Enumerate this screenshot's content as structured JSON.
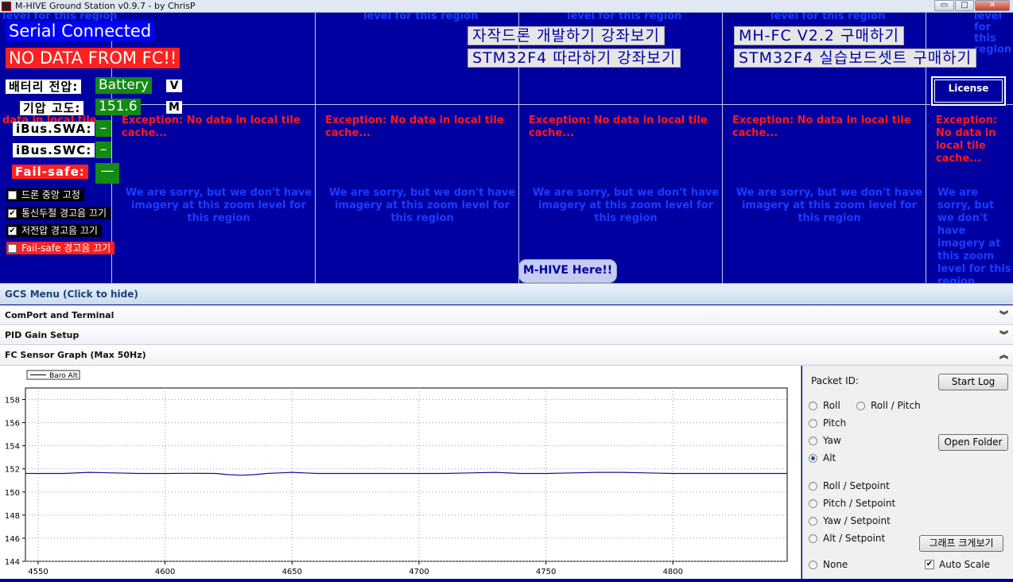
{
  "window": {
    "title": "M-HIVE Ground Station v0.9.7 - by ChrisP",
    "minimize_glyph": "▭",
    "maximize_glyph": "□",
    "close_glyph": "✕",
    "icon": "app-icon"
  },
  "map": {
    "tile_exception": "Exception: No data in local tile cache...",
    "tile_exception_cut": "data in local tile",
    "tile_sorry": "We are sorry, but we don't have imagery at this zoom level for this region",
    "tile_top_fragment": "level for this region",
    "marker": "M-HIVE Here!!"
  },
  "status": {
    "serial": "Serial Connected",
    "fc": "NO DATA FROM FC!!"
  },
  "telemetry": {
    "battery_label": "배터리 전압:",
    "battery_value": "Battery",
    "battery_unit": "V",
    "altitude_label": "기압 고도:",
    "altitude_value": "151.6",
    "altitude_unit": "M",
    "swa_label": "iBus.SWA:",
    "swa_value": "–",
    "swc_label": "iBus.SWC:",
    "swc_value": "–",
    "failsafe_label": "Fail-safe:",
    "failsafe_value": "—"
  },
  "options": [
    {
      "label": "드론 중앙 고정",
      "checked": false
    },
    {
      "label": "통신두절 경고음 끄기",
      "checked": true
    },
    {
      "label": "저전압 경고음 끄기",
      "checked": true
    },
    {
      "label": "Fail-safe 경고음 끄기",
      "checked": false
    }
  ],
  "check_glyph": "✔",
  "links": {
    "course1": "자작드론 개발하기 강좌보기",
    "course2": "STM32F4 따라하기 강좌보기",
    "buy1": "MH-FC V2.2 구매하기",
    "buy2": "STM32F4 실습보드셋트 구매하기",
    "license": "License"
  },
  "menu": {
    "gcs": "GCS Menu (Click to hide)",
    "panels": [
      {
        "label": "ComPort and Terminal",
        "chev": "︾"
      },
      {
        "label": "PID Gain Setup",
        "chev": "︾"
      },
      {
        "label": "FC Sensor Graph (Max 50Hz)",
        "chev": "︽"
      }
    ]
  },
  "side": {
    "packet_id_label": "Packet ID:",
    "start_log": "Start Log",
    "open_folder": "Open Folder",
    "graph_zoom": "그래프 크게보기",
    "auto_scale": "Auto Scale",
    "auto_scale_checked": true,
    "radios": [
      {
        "label": "Roll",
        "selected": false
      },
      {
        "label": "Roll / Pitch",
        "selected": false
      },
      {
        "label": "Pitch",
        "selected": false
      },
      {
        "label": "Yaw",
        "selected": false
      },
      {
        "label": "Alt",
        "selected": true
      },
      {
        "label": "Roll / Setpoint",
        "selected": false
      },
      {
        "label": "Pitch / Setpoint",
        "selected": false
      },
      {
        "label": "Yaw / Setpoint",
        "selected": false
      },
      {
        "label": "Alt / Setpoint",
        "selected": false
      },
      {
        "label": "None",
        "selected": false
      }
    ]
  },
  "colors": {
    "map_bg": "#0000a0",
    "status_red": "#ff2020",
    "status_blue": "#0000ff",
    "value_green": "#138a13",
    "series": "#1010a0"
  },
  "chart_data": {
    "type": "line",
    "legend": [
      "Baro Alt"
    ],
    "legend_position": "top-left",
    "grid": true,
    "xlim": [
      4545,
      4845
    ],
    "ylim": [
      144,
      159
    ],
    "x_ticks": [
      4550,
      4600,
      4650,
      4700,
      4750,
      4800
    ],
    "y_ticks": [
      144,
      146,
      148,
      150,
      152,
      154,
      156,
      158
    ],
    "series": [
      {
        "name": "Baro Alt",
        "x": [
          4545,
          4560,
          4570,
          4580,
          4590,
          4600,
          4610,
          4620,
          4625,
          4630,
          4635,
          4640,
          4645,
          4650,
          4655,
          4660,
          4670,
          4680,
          4690,
          4700,
          4710,
          4720,
          4730,
          4740,
          4750,
          4760,
          4770,
          4780,
          4790,
          4800,
          4810,
          4820,
          4830,
          4845
        ],
        "y": [
          151.6,
          151.6,
          151.7,
          151.65,
          151.6,
          151.6,
          151.62,
          151.6,
          151.5,
          151.45,
          151.5,
          151.6,
          151.65,
          151.7,
          151.65,
          151.6,
          151.6,
          151.6,
          151.6,
          151.6,
          151.6,
          151.65,
          151.7,
          151.6,
          151.6,
          151.65,
          151.7,
          151.7,
          151.65,
          151.6,
          151.6,
          151.6,
          151.6,
          151.6
        ]
      }
    ]
  }
}
